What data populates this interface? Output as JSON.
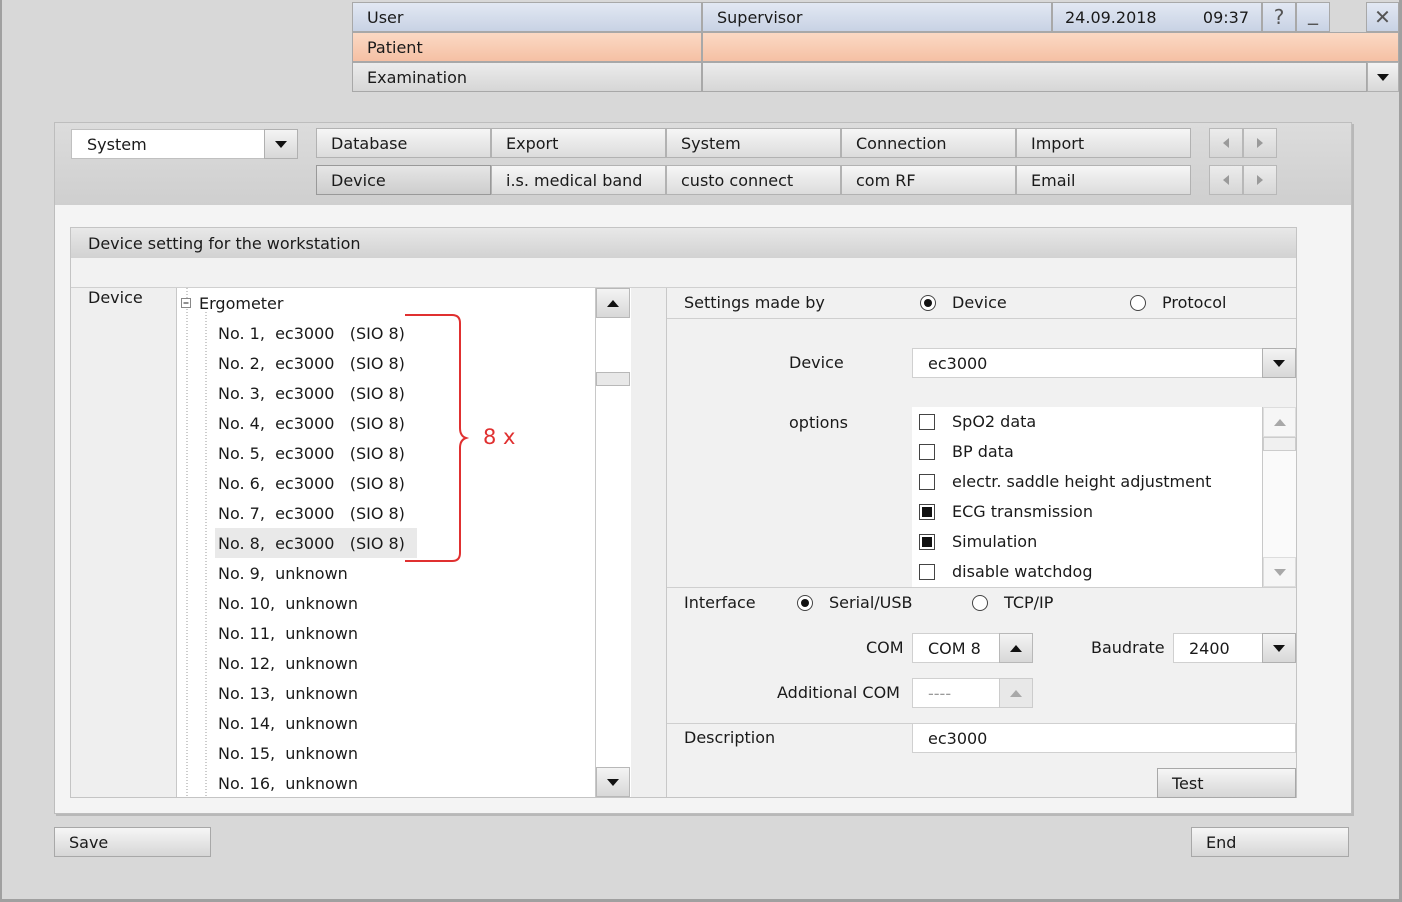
{
  "header": {
    "user_label": "User",
    "user_value": "Supervisor",
    "date": "24.09.2018",
    "time": "09:37",
    "help_glyph": "?",
    "minimize_glyph": "_",
    "close_glyph": "✕",
    "patient_label": "Patient",
    "patient_value": "",
    "examination_label": "Examination",
    "examination_value": ""
  },
  "category_select": "System",
  "tabs_row1": [
    "Database",
    "Export",
    "System",
    "Connection",
    "Import"
  ],
  "tabs_row2": [
    "Device",
    "i.s. medical band",
    "custo connect",
    "com RF",
    "Email"
  ],
  "selected_tab": "Device",
  "section_title": "Device setting for the workstation",
  "device_label": "Device",
  "tree": {
    "root": "Ergometer",
    "items": [
      "No. 1,  ec3000   (SIO 8)",
      "No. 2,  ec3000   (SIO 8)",
      "No. 3,  ec3000   (SIO 8)",
      "No. 4,  ec3000   (SIO 8)",
      "No. 5,  ec3000   (SIO 8)",
      "No. 6,  ec3000   (SIO 8)",
      "No. 7,  ec3000   (SIO 8)",
      "No. 8,  ec3000   (SIO 8)",
      "No. 9,  unknown",
      "No. 10,  unknown",
      "No. 11,  unknown",
      "No. 12,  unknown",
      "No. 13,  unknown",
      "No. 14,  unknown",
      "No. 15,  unknown",
      "No. 16,  unknown"
    ],
    "selected_index": 7
  },
  "annotation": {
    "text": "8 x",
    "color": "#e03030"
  },
  "settings": {
    "made_by_label": "Settings made by",
    "made_by_options": [
      "Device",
      "Protocol"
    ],
    "made_by_selected": "Device",
    "device_label": "Device",
    "device_value": "ec3000",
    "options_label": "options",
    "options": [
      {
        "label": "SpO2 data",
        "checked": false
      },
      {
        "label": "BP data",
        "checked": false
      },
      {
        "label": "electr. saddle height adjustment",
        "checked": false
      },
      {
        "label": "ECG transmission",
        "checked": true
      },
      {
        "label": "Simulation",
        "checked": true
      },
      {
        "label": "disable watchdog",
        "checked": false
      }
    ],
    "interface_label": "Interface",
    "interface_options": [
      "Serial/USB",
      "TCP/IP"
    ],
    "interface_selected": "Serial/USB",
    "com_label": "COM",
    "com_value": "COM 8",
    "baudrate_label": "Baudrate",
    "baudrate_value": "2400",
    "additional_com_label": "Additional COM",
    "additional_com_value": "----",
    "description_label": "Description",
    "description_value": "ec3000",
    "test_button": "Test"
  },
  "footer": {
    "save_button": "Save",
    "end_button": "End"
  }
}
